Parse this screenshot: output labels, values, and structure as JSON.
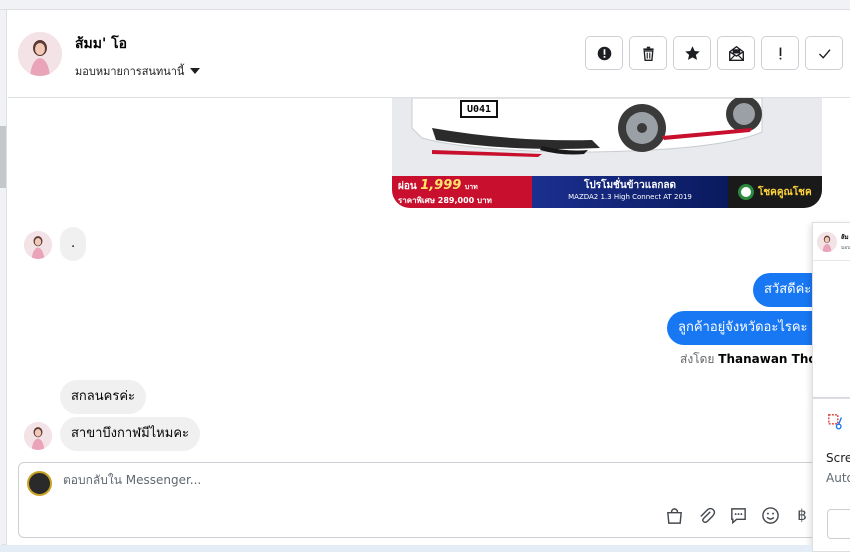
{
  "contact": {
    "name": "ส้มม' โอ",
    "assign_label": "มอบหมายการสนทนานี้"
  },
  "toolbar": {
    "buttons": [
      {
        "name": "spam-button",
        "icon": "alert-circle-icon"
      },
      {
        "name": "delete-button",
        "icon": "trash-icon"
      },
      {
        "name": "star-button",
        "icon": "star-icon"
      },
      {
        "name": "mark-unread-button",
        "icon": "envelope-open-icon"
      },
      {
        "name": "follow-up-button",
        "icon": "exclamation-icon"
      },
      {
        "name": "mark-done-button",
        "icon": "check-icon"
      }
    ]
  },
  "ad_banner": {
    "plate": "U041",
    "price_prefix": "ผ่อน",
    "price_value": "1,999",
    "price_unit": "บาท",
    "special_price": "ราคาพิเศษ 289,000 บาท",
    "promo_title": "โปรโมชั่นข้าวแลกลด",
    "model": "MAZDA2 1.3 High Connect AT 2019",
    "dealer": "โชคคูณโชค"
  },
  "messages": {
    "incoming_dot": ".",
    "outgoing_1": "สวัสดีค่ะ",
    "outgoing_2": "ลูกค้าอยู่จังหวัดอะไรคะ",
    "sent_by_prefix": "ส่งโดย",
    "sent_by_name": "Thanawan Thon",
    "incoming_2": "สกลนครค่ะ",
    "incoming_3": "สาขาบึงกาฬมีไหมคะ"
  },
  "composer": {
    "placeholder": "ตอบกลับใน Messenger..."
  },
  "popup": {
    "name": "ส้ม",
    "sub": "มอบ"
  },
  "side_panel": {
    "line1": "Scre",
    "line2": "Auto"
  },
  "colors": {
    "brand_blue": "#1877f2",
    "incoming_bubble": "#f0f0f0"
  }
}
